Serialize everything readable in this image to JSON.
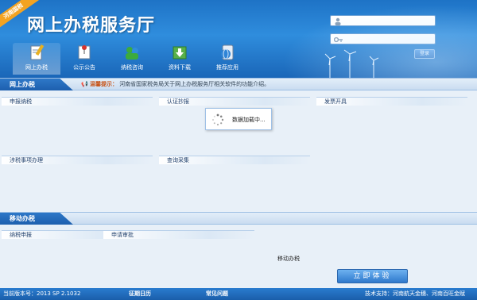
{
  "header": {
    "badge": "河南国税",
    "title": "网上办税服务厅",
    "nav": [
      {
        "label": "网上办税",
        "icon": "document-pen-icon"
      },
      {
        "label": "公示公告",
        "icon": "notice-pin-icon"
      },
      {
        "label": "纳税咨询",
        "icon": "consult-people-icon"
      },
      {
        "label": "资料下载",
        "icon": "download-icon"
      },
      {
        "label": "推荐应用",
        "icon": "app-globe-icon"
      }
    ],
    "login": {
      "username_placeholder": "",
      "password_placeholder": "",
      "login_label": "登录"
    }
  },
  "online": {
    "section_title": "网上办税",
    "notice_label": "温馨提示：",
    "notice_text": "河南省国家税务局关于网上办税服务厅相关软件的功能介绍。",
    "groups": [
      "申报纳税",
      "认证抄报",
      "发票开具",
      "涉税事项办理",
      "查询采集"
    ]
  },
  "loader_text": "数据加载中...",
  "mobile": {
    "section_title": "移动办税",
    "groups": [
      "纳税申报",
      "申请审批"
    ],
    "label": "移动办税",
    "try_label": "立即体验"
  },
  "footer": {
    "version": "当前版本号：2013 SP 2.1032",
    "calendar": "征期日历",
    "faq": "常见问题",
    "support": "技术支持：河南航天金穗、河南百旺金赋"
  },
  "colors": {
    "header": "#2f8ddd",
    "accent": "#1d5fae",
    "background": "#e8f0f8"
  }
}
